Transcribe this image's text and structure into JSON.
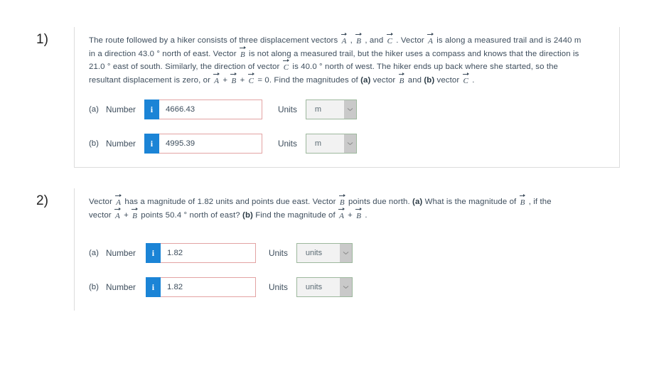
{
  "problems": [
    {
      "number": "1)",
      "question_parts": [
        {
          "t": "text",
          "v": "The route followed by a hiker consists of three displacement vectors "
        },
        {
          "t": "vec",
          "v": "A"
        },
        {
          "t": "text",
          "v": " , "
        },
        {
          "t": "vec",
          "v": "B"
        },
        {
          "t": "text",
          "v": " , and "
        },
        {
          "t": "vec",
          "v": "C"
        },
        {
          "t": "text",
          "v": " . Vector "
        },
        {
          "t": "vec",
          "v": "A"
        },
        {
          "t": "text",
          "v": " is along a measured trail and is 2440 m in a direction 43.0 ° north of east. Vector "
        },
        {
          "t": "vec",
          "v": "B"
        },
        {
          "t": "text",
          "v": " is not along a measured trail, but the hiker uses a compass and knows that the direction is 21.0 ° east of south. Similarly, the direction of vector "
        },
        {
          "t": "vec",
          "v": "C"
        },
        {
          "t": "text",
          "v": " is 40.0 ° north of west. The hiker ends up back where she started, so the resultant displacement is zero, or "
        },
        {
          "t": "vec",
          "v": "A"
        },
        {
          "t": "text",
          "v": " + "
        },
        {
          "t": "vec",
          "v": "B"
        },
        {
          "t": "text",
          "v": " + "
        },
        {
          "t": "vec",
          "v": "C"
        },
        {
          "t": "text",
          "v": " = 0. Find the magnitudes of "
        },
        {
          "t": "bold",
          "v": "(a)"
        },
        {
          "t": "text",
          "v": " vector "
        },
        {
          "t": "vec",
          "v": "B"
        },
        {
          "t": "text",
          "v": " and "
        },
        {
          "t": "bold",
          "v": "(b)"
        },
        {
          "t": "text",
          "v": " vector "
        },
        {
          "t": "vec",
          "v": "C"
        },
        {
          "t": "text",
          "v": " ."
        }
      ],
      "answers": [
        {
          "letter": "(a)",
          "number_label": "Number",
          "info_icon": "info-icon",
          "info_glyph": "i",
          "value": "4666.43",
          "value_state": "incorrect",
          "units_label": "Units",
          "units_value": "m",
          "units_state": "correct",
          "dropdown_icon": "chevron-down-icon"
        },
        {
          "letter": "(b)",
          "number_label": "Number",
          "info_icon": "info-icon",
          "info_glyph": "i",
          "value": "4995.39",
          "value_state": "incorrect",
          "units_label": "Units",
          "units_value": "m",
          "units_state": "correct",
          "dropdown_icon": "chevron-down-icon"
        }
      ]
    },
    {
      "number": "2)",
      "question_parts": [
        {
          "t": "text",
          "v": "Vector "
        },
        {
          "t": "vec",
          "v": "A"
        },
        {
          "t": "text",
          "v": " has a magnitude of 1.82 units and points due east. Vector "
        },
        {
          "t": "vec",
          "v": "B"
        },
        {
          "t": "text",
          "v": " points due north. "
        },
        {
          "t": "bold",
          "v": "(a)"
        },
        {
          "t": "text",
          "v": " What is the magnitude of "
        },
        {
          "t": "vec",
          "v": "B"
        },
        {
          "t": "text",
          "v": " , if the vector "
        },
        {
          "t": "vec",
          "v": "A"
        },
        {
          "t": "text",
          "v": " + "
        },
        {
          "t": "vec",
          "v": "B"
        },
        {
          "t": "text",
          "v": " points 50.4 ° north of east? "
        },
        {
          "t": "bold",
          "v": "(b)"
        },
        {
          "t": "text",
          "v": " Find the magnitude of "
        },
        {
          "t": "vec",
          "v": "A"
        },
        {
          "t": "text",
          "v": " + "
        },
        {
          "t": "vec",
          "v": "B"
        },
        {
          "t": "text",
          "v": " ."
        }
      ],
      "answers": [
        {
          "letter": "(a)",
          "number_label": "Number",
          "info_icon": "info-icon",
          "info_glyph": "i",
          "value": "1.82",
          "value_state": "incorrect",
          "units_label": "Units",
          "units_value": "units",
          "units_state": "correct",
          "dropdown_icon": "chevron-down-icon"
        },
        {
          "letter": "(b)",
          "number_label": "Number",
          "info_icon": "info-icon",
          "info_glyph": "i",
          "value": "1.82",
          "value_state": "incorrect",
          "units_label": "Units",
          "units_value": "units",
          "units_state": "correct",
          "dropdown_icon": "chevron-down-icon"
        }
      ]
    }
  ],
  "colors": {
    "info_button_blue": "#1b84d6",
    "incorrect_border": "#e3a3a3",
    "correct_border": "#9db89d",
    "text": "#3d4d5c",
    "divider": "#dcdcdc",
    "select_background": "#f2f2f2",
    "select_arrow_background": "#c9c9c9"
  }
}
